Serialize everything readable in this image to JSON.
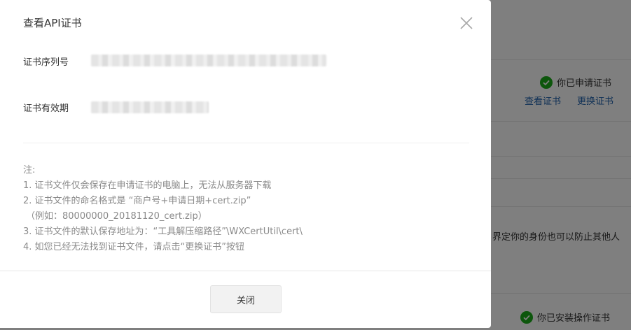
{
  "background": {
    "status_applied": "你已申请证书",
    "link_view": "查看证书",
    "link_replace": "更换证书",
    "partial_text": "界定你的身份也可以防止其他人",
    "status_installed": "你已安装操作证书",
    "accent_color": "#1aad19",
    "link_color": "#1b5eaa"
  },
  "dialog": {
    "title": "查看API证书",
    "close_icon": "close-icon",
    "fields": [
      {
        "label": "证书序列号",
        "value": ""
      },
      {
        "label": "证书有效期",
        "value": ""
      }
    ],
    "notes": {
      "heading": "注:",
      "lines": [
        "1. 证书文件仅会保存在申请证书的电脑上，无法从服务器下载",
        "2. 证书文件的命名格式是 “商户号+申请日期+cert.zip”",
        "（例如：80000000_20181120_cert.zip）",
        "3. 证书文件的默认保存地址为：“工具解压缩路径”\\WXCertUtil\\cert\\",
        "4. 如您已经无法找到证书文件，请点击“更换证书”按钮"
      ]
    },
    "close_button_label": "关闭"
  }
}
